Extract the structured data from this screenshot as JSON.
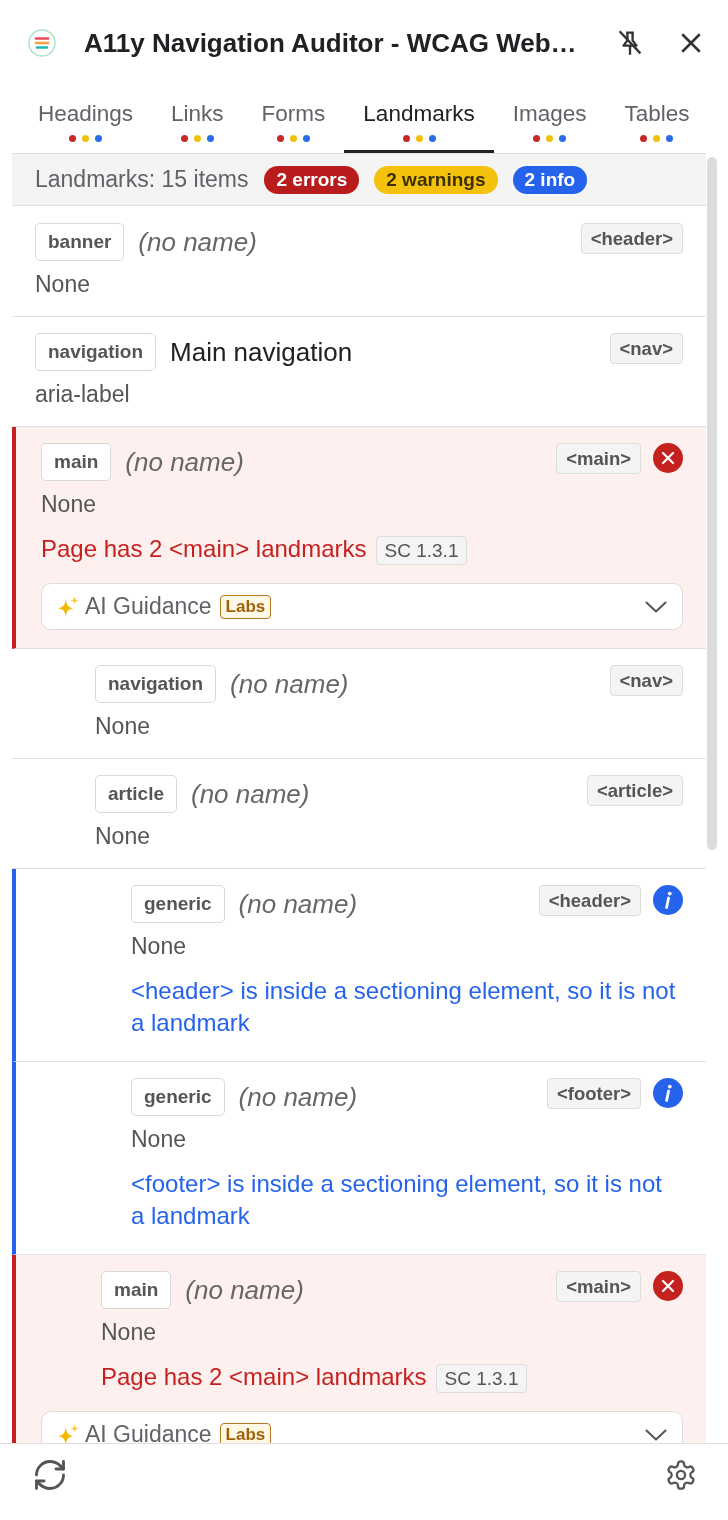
{
  "header": {
    "title": "A11y Navigation Auditor - WCAG Web…"
  },
  "tabs": [
    {
      "label": "Headings",
      "selected": false,
      "dots": [
        {
          "color": "#c62828"
        },
        {
          "color": "#f2c10f"
        },
        {
          "color": "#2b6be6"
        }
      ]
    },
    {
      "label": "Links",
      "selected": false,
      "dots": [
        {
          "color": "#c62828"
        },
        {
          "color": "#f2c10f"
        },
        {
          "color": "#2b6be6"
        }
      ]
    },
    {
      "label": "Forms",
      "selected": false,
      "dots": [
        {
          "color": "#c62828"
        },
        {
          "color": "#f2c10f"
        },
        {
          "color": "#2b6be6"
        }
      ]
    },
    {
      "label": "Landmarks",
      "selected": true,
      "dots": [
        {
          "color": "#c62828"
        },
        {
          "color": "#f2c10f"
        },
        {
          "color": "#2b6be6"
        }
      ]
    },
    {
      "label": "Images",
      "selected": false,
      "dots": [
        {
          "color": "#c62828"
        },
        {
          "color": "#f2c10f"
        },
        {
          "color": "#2b6be6"
        }
      ]
    },
    {
      "label": "Tables",
      "selected": false,
      "dots": [
        {
          "color": "#c62828"
        },
        {
          "color": "#f2c10f"
        },
        {
          "color": "#2b6be6"
        }
      ]
    }
  ],
  "summary": {
    "label": "Landmarks: 15 items",
    "counts": [
      {
        "kind": "error",
        "label": "2 errors"
      },
      {
        "kind": "warning",
        "label": "2 warnings"
      },
      {
        "kind": "info",
        "label": "2 info"
      }
    ]
  },
  "landmarks": [
    {
      "role": "banner",
      "name": "(no name)",
      "has_name": false,
      "tag": "<header>",
      "name_source": "None"
    },
    {
      "role": "navigation",
      "name": "Main navigation",
      "has_name": true,
      "tag": "<nav>",
      "name_source": "aria-label"
    },
    {
      "role": "main",
      "name": "(no name)",
      "has_name": false,
      "tag": "<main>",
      "name_source": "None",
      "issue": {
        "kind": "error",
        "message": "Page has 2 <main> landmarks",
        "criterion": "SC 1.3.1",
        "guidance": {
          "label": "AI Guidance",
          "badge": "Labs",
          "expanded": false
        }
      },
      "children": [
        {
          "role": "navigation",
          "name": "(no name)",
          "has_name": false,
          "tag": "<nav>",
          "name_source": "None"
        },
        {
          "role": "article",
          "name": "(no name)",
          "has_name": false,
          "tag": "<article>",
          "name_source": "None",
          "children": [
            {
              "role": "generic",
              "name": "(no name)",
              "has_name": false,
              "tag": "<header>",
              "name_source": "None",
              "issue": {
                "kind": "info",
                "message": "<header> is inside a sectioning element, so it is not a landmark"
              }
            },
            {
              "role": "generic",
              "name": "(no name)",
              "has_name": false,
              "tag": "<footer>",
              "name_source": "None",
              "issue": {
                "kind": "info",
                "message": "<footer> is inside a sectioning element, so it is not a landmark"
              }
            }
          ]
        },
        {
          "role": "main",
          "name": "(no name)",
          "has_name": false,
          "tag": "<main>",
          "name_source": "None",
          "issue": {
            "kind": "error",
            "message": "Page has 2 <main> landmarks",
            "criterion": "SC 1.3.1",
            "guidance": {
              "label": "AI Guidance",
              "badge": "Labs",
              "expanded": false
            }
          }
        }
      ]
    }
  ]
}
